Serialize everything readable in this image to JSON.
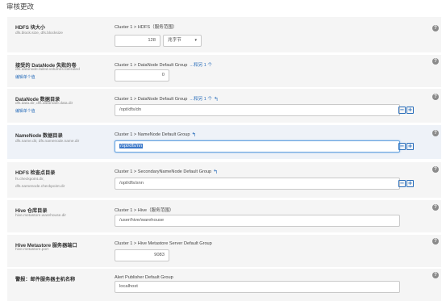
{
  "page_title": "审核更改",
  "help_label": "?",
  "controls": {
    "remove_glyph": "−",
    "add_glyph": "+",
    "undo_glyph": "↰",
    "dropdown_caret": "▾"
  },
  "rows": [
    {
      "name": "HDFS 块大小",
      "key_lines": [
        "dfs.block.size, dfs.blocksize"
      ],
      "scope": "Cluster 1 > HDFS（服务范围）",
      "value": "128",
      "unit": "兆字节"
    },
    {
      "name": "接受的 DataNode 失败的卷",
      "key_lines": [
        "dfs.datanode.failed.volumes.tolerated"
      ],
      "edit_link": "编辑单个值",
      "scope": "Cluster 1 > DataNode Default Group",
      "scope_extra": "...和另 1 个",
      "value": "0"
    },
    {
      "name": "DataNode 数据目录",
      "key_lines": [
        "dfs.data.dir, dfs.datanode.data.dir"
      ],
      "edit_link": "编辑单个值",
      "scope": "Cluster 1 > DataNode Default Group",
      "scope_extra": "...和另 1 个",
      "value": "/opt/dfs/dn"
    },
    {
      "name": "NameNode 数据目录",
      "key_lines": [
        "dfs.name.dir, dfs.namenode.name.dir"
      ],
      "scope": "Cluster 1 > NameNode Default Group",
      "value": "/opt/dfs/nn"
    },
    {
      "name": "HDFS 检查点目录",
      "key_lines": [
        "fs.checkpoint.dir,",
        "dfs.namenode.checkpoint.dir"
      ],
      "scope": "Cluster 1 > SecondaryNameNode Default Group",
      "value": "/opt/dfs/snn"
    },
    {
      "name": "Hive 仓库目录",
      "key_lines": [
        "hive.metastore.warehouse.dir"
      ],
      "scope": "Cluster 1 > Hive（服务范围）",
      "value": "/user/hive/warehouse"
    },
    {
      "name": "Hive Metastore 服务器端口",
      "key_lines": [
        "hive.metastore.port"
      ],
      "scope": "Cluster 1 > Hive Metastore Server Default Group",
      "value": "9083"
    },
    {
      "name": "警报：邮件服务器主机名称",
      "key_lines": [],
      "scope": "Alert Publisher Default Group",
      "value": "localhost"
    }
  ]
}
